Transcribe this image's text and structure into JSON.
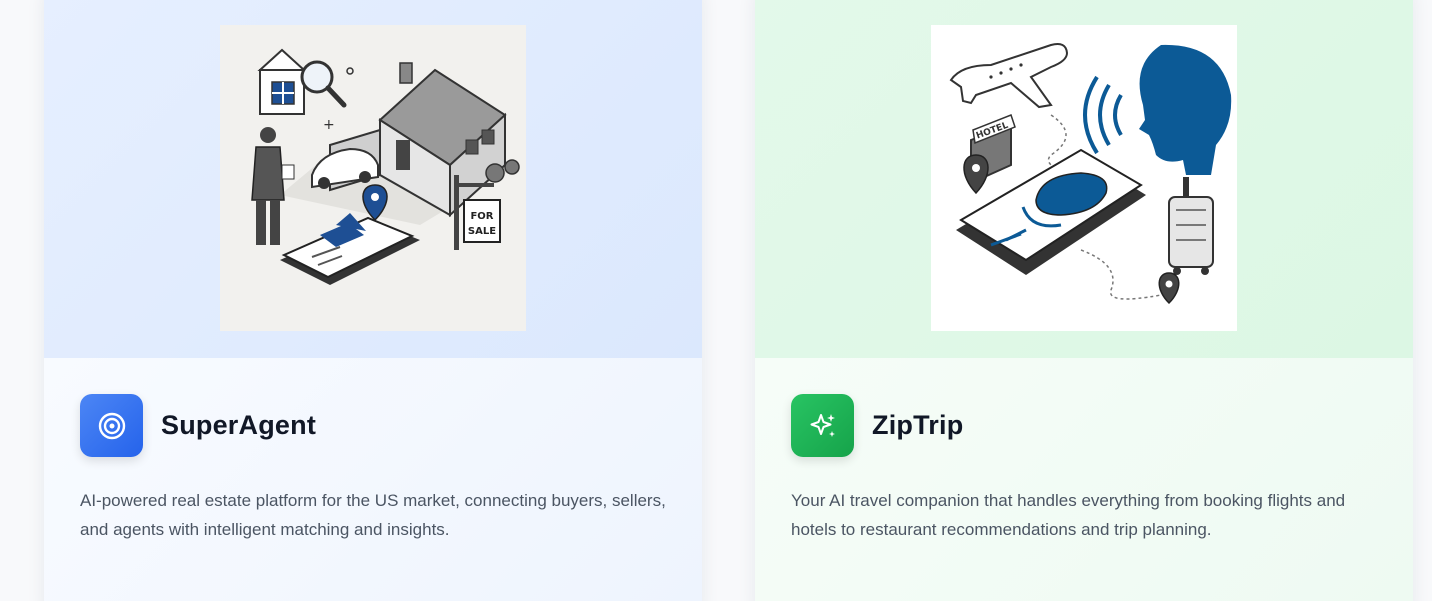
{
  "cards": [
    {
      "title": "SuperAgent",
      "description": "AI-powered real estate platform for the US market, connecting buyers, sellers, and agents with intelligent matching and insights.",
      "icon": "target-icon",
      "accent": "#2563eb",
      "illustration_text": "FOR SALE"
    },
    {
      "title": "ZipTrip",
      "description": "Your AI travel companion that handles everything from booking flights and hotels to restaurant recommendations and trip planning.",
      "icon": "sparkles-icon",
      "accent": "#16a34a",
      "illustration_text": "HOTEL"
    }
  ]
}
